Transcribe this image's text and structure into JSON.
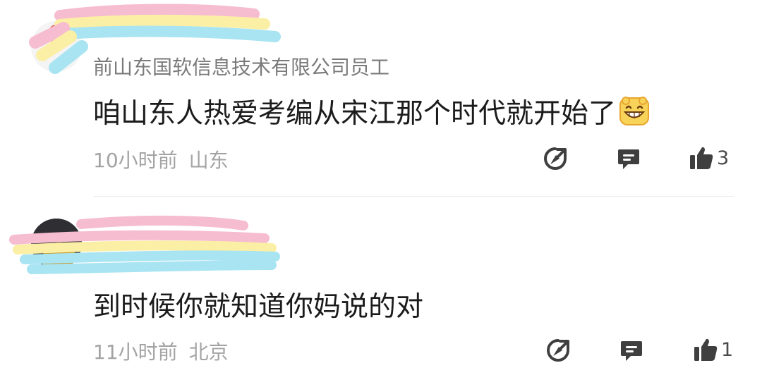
{
  "comments": [
    {
      "username": "",
      "subtitle": "前山东国软信息技术有限公司员工",
      "text": "咱山东人热爱考编从宋江那个时代就开始了",
      "emoji": "grinning-face-icon",
      "time": "10小时前",
      "location": "山东",
      "likes": "3"
    },
    {
      "username": "",
      "subtitle": "",
      "text": "到时候你就知道你妈说的对",
      "emoji": "",
      "time": "11小时前",
      "location": "北京",
      "likes": "1"
    }
  ],
  "colors": {
    "text": "#1b1b1b",
    "meta": "#a3a3a3",
    "icon": "#3f3f3f",
    "scribble_pink": "#f6bcd0",
    "scribble_yellow": "#fbefa6",
    "scribble_blue": "#a8e4f2"
  }
}
